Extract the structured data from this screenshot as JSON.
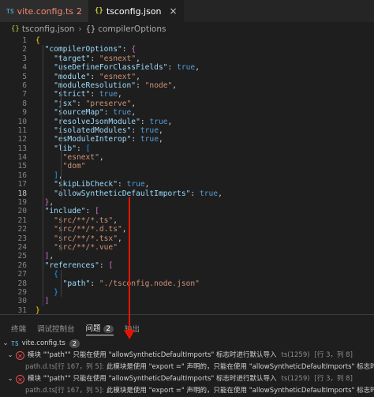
{
  "tabs": [
    {
      "badge": "TS",
      "label": "vite.config.ts",
      "count": "2",
      "active": false
    },
    {
      "badge": "{}",
      "label": "tsconfig.json",
      "close": "×",
      "active": true
    }
  ],
  "breadcrumb": {
    "file": "tsconfig.json",
    "icon": "{}",
    "separator": "›",
    "symbol": "compilerOptions"
  },
  "lines": [
    {
      "n": "1",
      "tokens": [
        [
          "br1",
          "{"
        ]
      ]
    },
    {
      "n": "2",
      "tokens": [
        [
          "p",
          "  "
        ],
        [
          "k",
          "\"compilerOptions\""
        ],
        [
          "p",
          ": "
        ],
        [
          "br2",
          "{"
        ]
      ]
    },
    {
      "n": "3",
      "tokens": [
        [
          "p",
          "    "
        ],
        [
          "k",
          "\"target\""
        ],
        [
          "p",
          ": "
        ],
        [
          "s",
          "\"esnext\""
        ],
        [
          "p",
          ","
        ]
      ]
    },
    {
      "n": "4",
      "tokens": [
        [
          "p",
          "    "
        ],
        [
          "k",
          "\"useDefineForClassFields\""
        ],
        [
          "p",
          ": "
        ],
        [
          "b",
          "true"
        ],
        [
          "p",
          ","
        ]
      ]
    },
    {
      "n": "5",
      "tokens": [
        [
          "p",
          "    "
        ],
        [
          "k",
          "\"module\""
        ],
        [
          "p",
          ": "
        ],
        [
          "s",
          "\"esnext\""
        ],
        [
          "p",
          ","
        ]
      ]
    },
    {
      "n": "6",
      "tokens": [
        [
          "p",
          "    "
        ],
        [
          "k",
          "\"moduleResolution\""
        ],
        [
          "p",
          ": "
        ],
        [
          "s",
          "\"node\""
        ],
        [
          "p",
          ","
        ]
      ]
    },
    {
      "n": "7",
      "tokens": [
        [
          "p",
          "    "
        ],
        [
          "k",
          "\"strict\""
        ],
        [
          "p",
          ": "
        ],
        [
          "b",
          "true"
        ],
        [
          "p",
          ","
        ]
      ]
    },
    {
      "n": "8",
      "tokens": [
        [
          "p",
          "    "
        ],
        [
          "k",
          "\"jsx\""
        ],
        [
          "p",
          ": "
        ],
        [
          "s",
          "\"preserve\""
        ],
        [
          "p",
          ","
        ]
      ]
    },
    {
      "n": "9",
      "tokens": [
        [
          "p",
          "    "
        ],
        [
          "k",
          "\"sourceMap\""
        ],
        [
          "p",
          ": "
        ],
        [
          "b",
          "true"
        ],
        [
          "p",
          ","
        ]
      ]
    },
    {
      "n": "10",
      "tokens": [
        [
          "p",
          "    "
        ],
        [
          "k",
          "\"resolveJsonModule\""
        ],
        [
          "p",
          ": "
        ],
        [
          "b",
          "true"
        ],
        [
          "p",
          ","
        ]
      ]
    },
    {
      "n": "11",
      "tokens": [
        [
          "p",
          "    "
        ],
        [
          "k",
          "\"isolatedModules\""
        ],
        [
          "p",
          ": "
        ],
        [
          "b",
          "true"
        ],
        [
          "p",
          ","
        ]
      ]
    },
    {
      "n": "12",
      "tokens": [
        [
          "p",
          "    "
        ],
        [
          "k",
          "\"esModuleInterop\""
        ],
        [
          "p",
          ": "
        ],
        [
          "b",
          "true"
        ],
        [
          "p",
          ","
        ]
      ]
    },
    {
      "n": "13",
      "tokens": [
        [
          "p",
          "    "
        ],
        [
          "k",
          "\"lib\""
        ],
        [
          "p",
          ": "
        ],
        [
          "br3",
          "["
        ]
      ]
    },
    {
      "n": "14",
      "tokens": [
        [
          "p",
          "      "
        ],
        [
          "s",
          "\"esnext\""
        ],
        [
          "p",
          ","
        ]
      ]
    },
    {
      "n": "15",
      "tokens": [
        [
          "p",
          "      "
        ],
        [
          "s",
          "\"dom\""
        ]
      ]
    },
    {
      "n": "16",
      "tokens": [
        [
          "p",
          "    "
        ],
        [
          "br3",
          "]"
        ],
        [
          "p",
          ","
        ]
      ]
    },
    {
      "n": "17",
      "tokens": [
        [
          "p",
          "    "
        ],
        [
          "k",
          "\"skipLibCheck\""
        ],
        [
          "p",
          ": "
        ],
        [
          "b",
          "true"
        ],
        [
          "p",
          ","
        ]
      ]
    },
    {
      "n": "18",
      "cur": true,
      "tokens": [
        [
          "p",
          "    "
        ],
        [
          "k",
          "\"allowSyntheticDefaultImports\""
        ],
        [
          "p",
          ": "
        ],
        [
          "b",
          "true"
        ],
        [
          "p",
          ","
        ]
      ]
    },
    {
      "n": "19",
      "tokens": [
        [
          "p",
          "  "
        ],
        [
          "br2",
          "}"
        ],
        [
          "p",
          ","
        ]
      ]
    },
    {
      "n": "20",
      "tokens": [
        [
          "p",
          "  "
        ],
        [
          "k",
          "\"include\""
        ],
        [
          "p",
          ": "
        ],
        [
          "br2",
          "["
        ]
      ]
    },
    {
      "n": "21",
      "tokens": [
        [
          "p",
          "    "
        ],
        [
          "s",
          "\"src/**/*.ts\""
        ],
        [
          "p",
          ","
        ]
      ]
    },
    {
      "n": "22",
      "tokens": [
        [
          "p",
          "    "
        ],
        [
          "s",
          "\"src/**/*.d.ts\""
        ],
        [
          "p",
          ","
        ]
      ]
    },
    {
      "n": "23",
      "tokens": [
        [
          "p",
          "    "
        ],
        [
          "s",
          "\"src/**/*.tsx\""
        ],
        [
          "p",
          ","
        ]
      ]
    },
    {
      "n": "24",
      "tokens": [
        [
          "p",
          "    "
        ],
        [
          "s",
          "\"src/**/*.vue\""
        ]
      ]
    },
    {
      "n": "25",
      "tokens": [
        [
          "p",
          "  "
        ],
        [
          "br2",
          "]"
        ],
        [
          "p",
          ","
        ]
      ]
    },
    {
      "n": "26",
      "tokens": [
        [
          "p",
          "  "
        ],
        [
          "k",
          "\"references\""
        ],
        [
          "p",
          ": "
        ],
        [
          "br2",
          "["
        ]
      ]
    },
    {
      "n": "27",
      "tokens": [
        [
          "p",
          "    "
        ],
        [
          "br3",
          "{"
        ]
      ]
    },
    {
      "n": "28",
      "tokens": [
        [
          "p",
          "      "
        ],
        [
          "k",
          "\"path\""
        ],
        [
          "p",
          ": "
        ],
        [
          "s",
          "\"./tsconfig.node.json\""
        ]
      ]
    },
    {
      "n": "29",
      "tokens": [
        [
          "p",
          "    "
        ],
        [
          "br3",
          "}"
        ]
      ]
    },
    {
      "n": "30",
      "tokens": [
        [
          "p",
          "  "
        ],
        [
          "br2",
          "]"
        ]
      ]
    },
    {
      "n": "31",
      "tokens": [
        [
          "br1",
          "}"
        ]
      ]
    }
  ],
  "panel": {
    "tabs": [
      {
        "label": "终端",
        "active": false
      },
      {
        "label": "调试控制台",
        "active": false
      },
      {
        "label": "问题",
        "active": true,
        "badge": "2"
      },
      {
        "label": "输出",
        "active": false
      }
    ]
  },
  "problems": {
    "file": "vite.config.ts",
    "count": "2",
    "items": [
      {
        "message": "模块 \"\"path\"\" 只能在使用 \"allowSyntheticDefaultImports\" 标志时进行默认导入",
        "source": "ts(1259)",
        "location": "[行 3，列 8]",
        "detail_file": "path.d.ts[行 167，列 5]:",
        "detail_text": "此模块是使用 \"export =\" 声明的，只能在使用 \"allowSyntheticDefaultImports\" 标志时进行默认导入。"
      },
      {
        "message": "模块 \"\"path\"\" 只能在使用 \"allowSyntheticDefaultImports\" 标志时进行默认导入",
        "source": "ts(1259)",
        "location": "[行 3，列 8]",
        "detail_file": "path.d.ts[行 167，列 5]:",
        "detail_text": "此模块是使用 \"export =\" 声明的，只能在使用 \"allowSyntheticDefaultImports\" 标志时进行默认导入。"
      }
    ]
  },
  "colors": {
    "accent": "#e51400",
    "error": "#f14c4c",
    "background": "#1e1e1e"
  }
}
